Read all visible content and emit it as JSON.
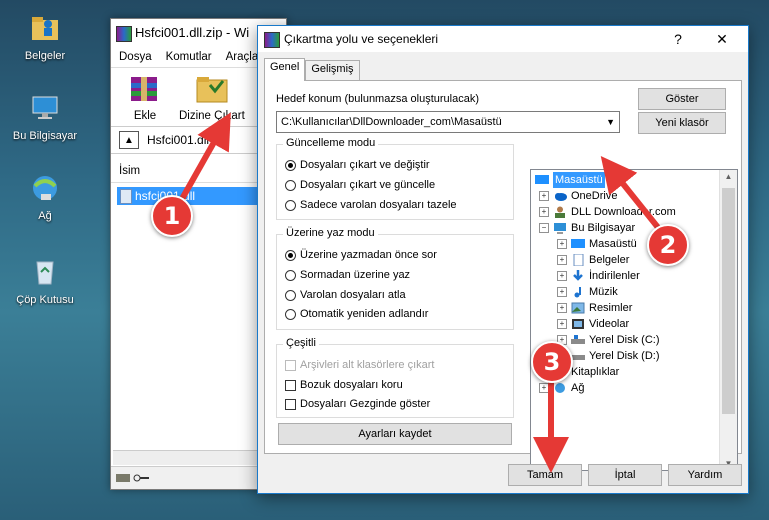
{
  "desktop": {
    "icons": [
      {
        "label": "Belgeler",
        "icon": "documents-folder-icon"
      },
      {
        "label": "Bu Bilgisayar",
        "icon": "computer-icon"
      },
      {
        "label": "Ağ",
        "icon": "network-icon"
      },
      {
        "label": "Çöp Kutusu",
        "icon": "recycle-bin-icon"
      }
    ]
  },
  "archiver": {
    "title": "Hsfci001.dll.zip - Wi",
    "menu": [
      "Dosya",
      "Komutlar",
      "Araçla"
    ],
    "toolbar": [
      "Ekle",
      "Dizine Çıkart"
    ],
    "path": "Hsfci001.dll",
    "column": "İsim",
    "file": "hsfci001.dll"
  },
  "dialog": {
    "title": "Çıkartma yolu ve seçenekleri",
    "help": "?",
    "close": "✕",
    "tabs": [
      "Genel",
      "Gelişmiş"
    ],
    "dest_label": "Hedef konum (bulunmazsa oluşturulacak)",
    "dest_value": "C:\\Kullanıcılar\\DllDownloader_com\\Masaüstü",
    "show_btn": "Göster",
    "new_folder_btn": "Yeni klasör",
    "update_mode": {
      "title": "Güncelleme modu",
      "options": [
        "Dosyaları çıkart ve değiştir",
        "Dosyaları çıkart ve güncelle",
        "Sadece varolan dosyaları tazele"
      ],
      "selected": 0
    },
    "overwrite_mode": {
      "title": "Üzerine yaz modu",
      "options": [
        "Üzerine yazmadan önce sor",
        "Sormadan üzerine yaz",
        "Varolan dosyaları atla",
        "Otomatik yeniden adlandır"
      ],
      "selected": 0
    },
    "misc": {
      "title": "Çeşitli",
      "options": [
        "Arşivleri alt klasörlere çıkart",
        "Bozuk dosyaları koru",
        "Dosyaları Gezginde göster"
      ]
    },
    "save_btn": "Ayarları kaydet",
    "tree": [
      {
        "label": "Masaüstü",
        "level": 0,
        "selected": true,
        "icon": "desktop-icon"
      },
      {
        "label": "OneDrive",
        "level": 1,
        "icon": "onedrive-icon"
      },
      {
        "label": "DLL Downloader.com",
        "level": 1,
        "icon": "user-icon"
      },
      {
        "label": "Bu Bilgisayar",
        "level": 1,
        "icon": "computer-icon"
      },
      {
        "label": "Masaüstü",
        "level": 2,
        "icon": "desktop-icon"
      },
      {
        "label": "Belgeler",
        "level": 2,
        "icon": "documents-icon"
      },
      {
        "label": "İndirilenler",
        "level": 2,
        "icon": "downloads-icon"
      },
      {
        "label": "Müzik",
        "level": 2,
        "icon": "music-icon"
      },
      {
        "label": "Resimler",
        "level": 2,
        "icon": "pictures-icon"
      },
      {
        "label": "Videolar",
        "level": 2,
        "icon": "videos-icon"
      },
      {
        "label": "Yerel Disk (C:)",
        "level": 2,
        "icon": "disk-icon"
      },
      {
        "label": "Yerel Disk (D:)",
        "level": 2,
        "icon": "disk-icon"
      },
      {
        "label": "Kitaplıklar",
        "level": 1,
        "icon": "libraries-icon"
      },
      {
        "label": "Ağ",
        "level": 1,
        "icon": "network-icon"
      }
    ],
    "ok_btn": "Tamam",
    "cancel_btn": "İptal",
    "help_btn": "Yardım"
  },
  "callouts": [
    "1",
    "2",
    "3"
  ],
  "colors": {
    "accent": "#3399ff",
    "callout": "#e53935"
  }
}
